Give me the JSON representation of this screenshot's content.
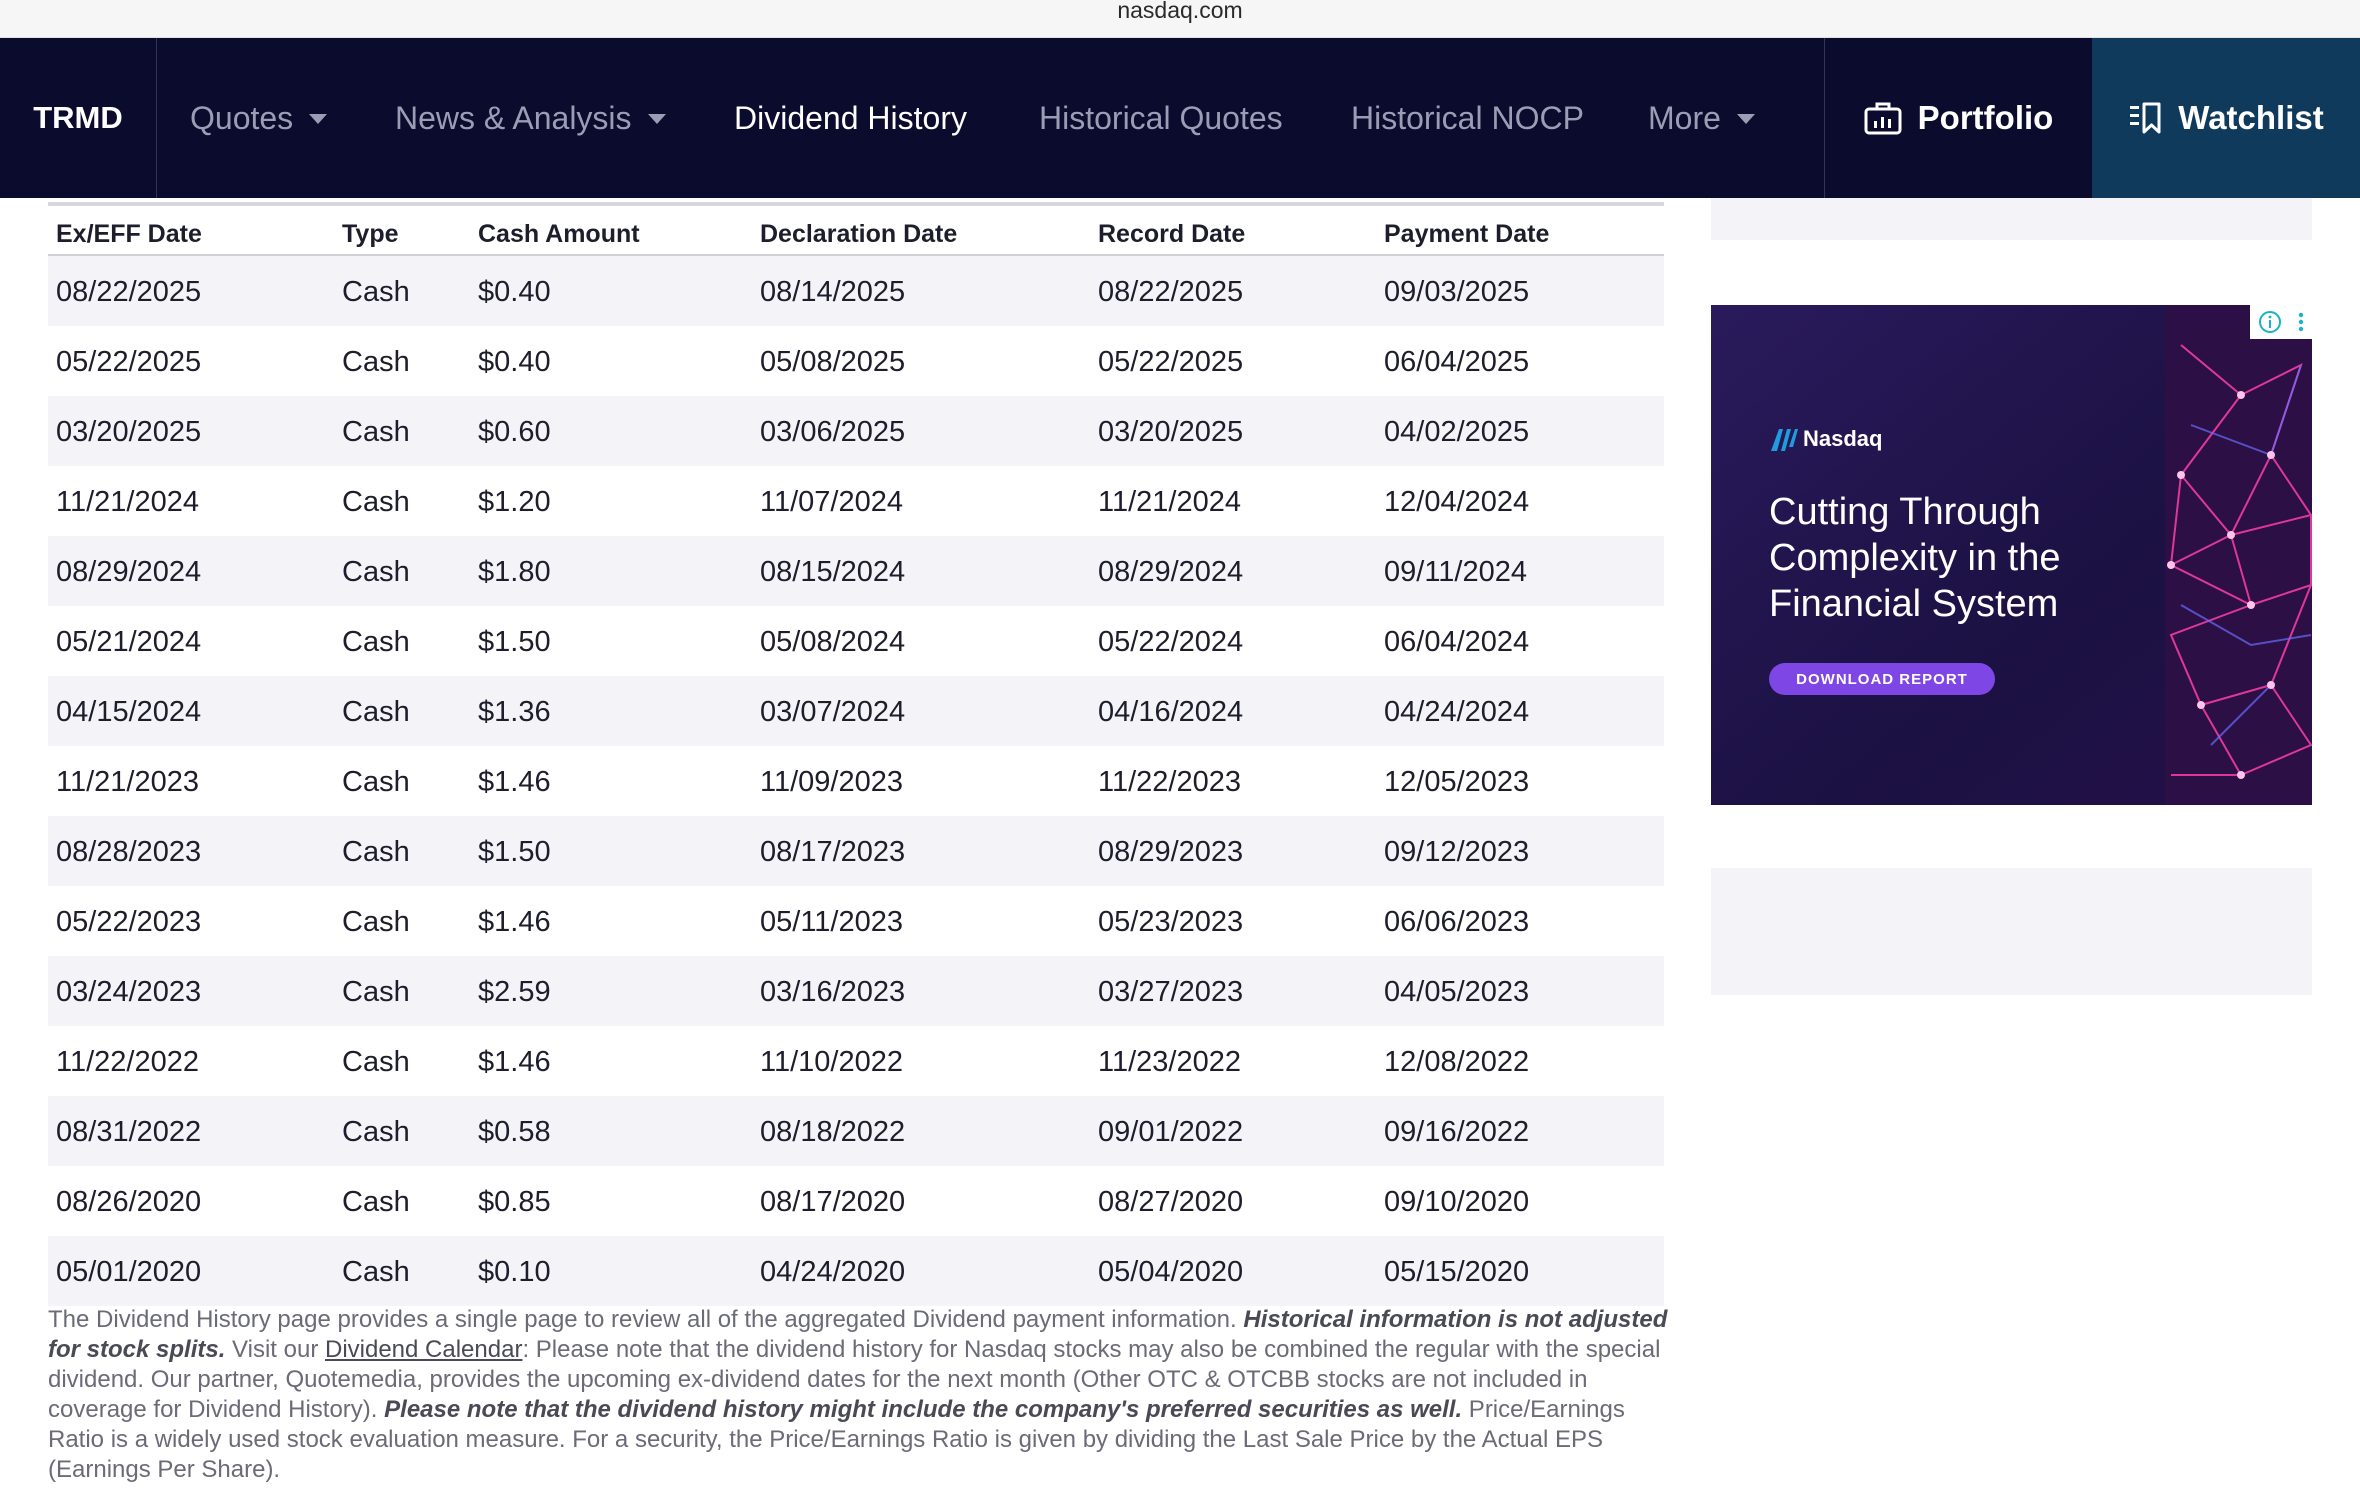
{
  "browser": {
    "url": "nasdaq.com"
  },
  "nav": {
    "symbol": "TRMD",
    "items": [
      {
        "label": "Quotes",
        "dropdown": true
      },
      {
        "label": "News & Analysis",
        "dropdown": true
      },
      {
        "label": "Dividend History",
        "dropdown": false,
        "active": true
      },
      {
        "label": "Historical Quotes",
        "dropdown": false
      },
      {
        "label": "Historical NOCP",
        "dropdown": false
      },
      {
        "label": "More",
        "dropdown": true
      }
    ],
    "portfolio_label": "Portfolio",
    "watchlist_label": "Watchlist",
    "icons": {
      "portfolio": "briefcase-chart-icon",
      "watchlist": "watchlist-icon"
    }
  },
  "table": {
    "headers": [
      "Ex/EFF Date",
      "Type",
      "Cash Amount",
      "Declaration Date",
      "Record Date",
      "Payment Date"
    ],
    "rows": [
      [
        "08/22/2025",
        "Cash",
        "$0.40",
        "08/14/2025",
        "08/22/2025",
        "09/03/2025"
      ],
      [
        "05/22/2025",
        "Cash",
        "$0.40",
        "05/08/2025",
        "05/22/2025",
        "06/04/2025"
      ],
      [
        "03/20/2025",
        "Cash",
        "$0.60",
        "03/06/2025",
        "03/20/2025",
        "04/02/2025"
      ],
      [
        "11/21/2024",
        "Cash",
        "$1.20",
        "11/07/2024",
        "11/21/2024",
        "12/04/2024"
      ],
      [
        "08/29/2024",
        "Cash",
        "$1.80",
        "08/15/2024",
        "08/29/2024",
        "09/11/2024"
      ],
      [
        "05/21/2024",
        "Cash",
        "$1.50",
        "05/08/2024",
        "05/22/2024",
        "06/04/2024"
      ],
      [
        "04/15/2024",
        "Cash",
        "$1.36",
        "03/07/2024",
        "04/16/2024",
        "04/24/2024"
      ],
      [
        "11/21/2023",
        "Cash",
        "$1.46",
        "11/09/2023",
        "11/22/2023",
        "12/05/2023"
      ],
      [
        "08/28/2023",
        "Cash",
        "$1.50",
        "08/17/2023",
        "08/29/2023",
        "09/12/2023"
      ],
      [
        "05/22/2023",
        "Cash",
        "$1.46",
        "05/11/2023",
        "05/23/2023",
        "06/06/2023"
      ],
      [
        "03/24/2023",
        "Cash",
        "$2.59",
        "03/16/2023",
        "03/27/2023",
        "04/05/2023"
      ],
      [
        "11/22/2022",
        "Cash",
        "$1.46",
        "11/10/2022",
        "11/23/2022",
        "12/08/2022"
      ],
      [
        "08/31/2022",
        "Cash",
        "$0.58",
        "08/18/2022",
        "09/01/2022",
        "09/16/2022"
      ],
      [
        "08/26/2020",
        "Cash",
        "$0.85",
        "08/17/2020",
        "08/27/2020",
        "09/10/2020"
      ],
      [
        "05/01/2020",
        "Cash",
        "$0.10",
        "04/24/2020",
        "05/04/2020",
        "05/15/2020"
      ]
    ]
  },
  "footnote": {
    "part1": "The Dividend History page provides a single page to review all of the aggregated Dividend payment information. ",
    "bold1": "Historical information is not adjusted for stock splits.",
    "part2": "  Visit our ",
    "link": "Dividend Calendar",
    "part3": ": Please note that the dividend history for Nasdaq stocks may also be combined the regular with the special dividend. Our partner, Quotemedia, provides the upcoming ex-dividend dates for the next month (Other OTC & OTCBB stocks are not included in coverage for Dividend History).  ",
    "bold2": "Please note that the dividend history might include the company's preferred securities as well.",
    "part4": " Price/Earnings Ratio is a widely used stock evaluation measure. For a security, the Price/Earnings Ratio is given by dividing the Last Sale Price by the Actual EPS (Earnings Per Share)."
  },
  "ad": {
    "brand": "Nasdaq",
    "headline": [
      "Cutting Through",
      "Complexity in the",
      "Financial System"
    ],
    "cta": "DOWNLOAD REPORT",
    "colors": {
      "background": "#1e1346",
      "cta": "#7f46e6",
      "mesh": "#ff3fa8"
    }
  },
  "colors": {
    "nav_bg": "#0b0b2e",
    "watchlist_bg": "#0f3a5c",
    "row_stripe": "#f4f4f8"
  }
}
